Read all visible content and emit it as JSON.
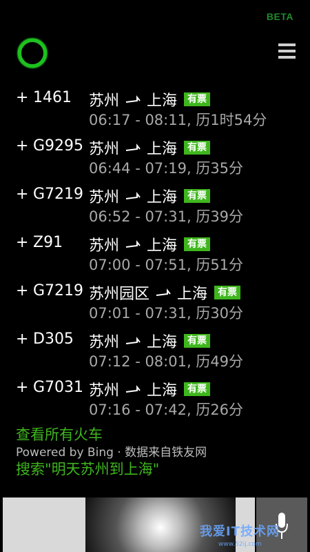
{
  "header": {
    "beta_label": "BETA",
    "menu_icon": "hamburger-menu-icon",
    "cortana_icon": "cortana-ring-icon"
  },
  "results": [
    {
      "plus": "+",
      "train": "1461",
      "from": "苏州",
      "to": "上海",
      "badge": "有票",
      "time": "06:17 - 08:11, 历1时54分"
    },
    {
      "plus": "+",
      "train": "G9295",
      "from": "苏州",
      "to": "上海",
      "badge": "有票",
      "time": "06:44 - 07:19, 历35分"
    },
    {
      "plus": "+",
      "train": "G7219",
      "from": "苏州",
      "to": "上海",
      "badge": "有票",
      "time": "06:52 - 07:31, 历39分"
    },
    {
      "plus": "+",
      "train": "Z91",
      "from": "苏州",
      "to": "上海",
      "badge": "有票",
      "time": "07:00 - 07:51, 历51分"
    },
    {
      "plus": "+",
      "train": "G7219",
      "from": "苏州园区",
      "to": "上海",
      "badge": "有票",
      "time": "07:01 - 07:31, 历30分"
    },
    {
      "plus": "+",
      "train": "D305",
      "from": "苏州",
      "to": "上海",
      "badge": "有票",
      "time": "07:12 - 08:01, 历49分"
    },
    {
      "plus": "+",
      "train": "G7031",
      "from": "苏州",
      "to": "上海",
      "badge": "有票",
      "time": "07:16 - 07:42, 历26分"
    }
  ],
  "footer": {
    "view_all": "查看所有火车",
    "powered_by": "Powered by Bing · 数据来自铁友网",
    "search_link": "搜索\"明天苏州到上海\""
  },
  "watermark": {
    "text": "我爱IT技术网",
    "url": "www.52ij.com"
  },
  "colors": {
    "accent": "#3fb61e",
    "beta": "#1f8a2a",
    "muted": "#a9a9a9"
  }
}
